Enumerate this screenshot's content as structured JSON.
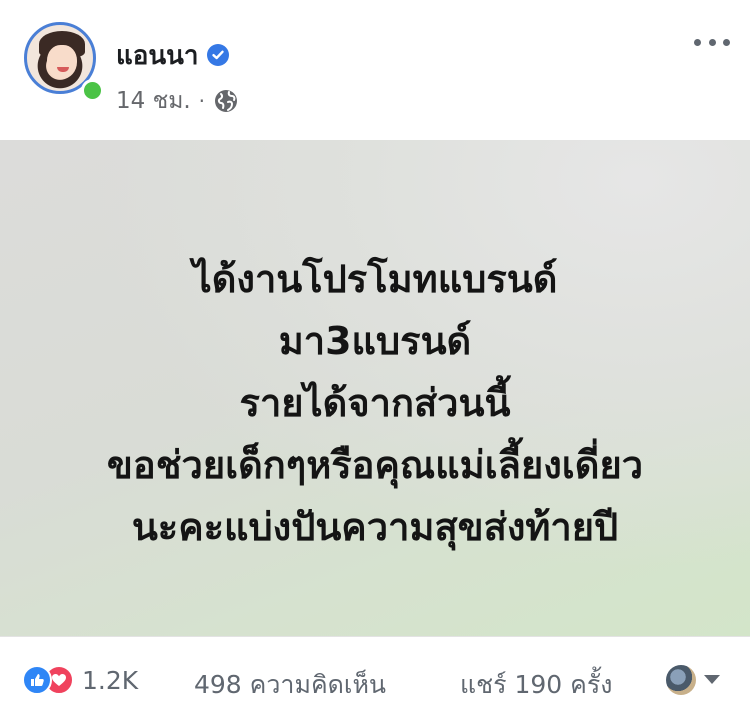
{
  "post": {
    "author_name": "แอนนา",
    "time": "14 ชม.",
    "separator": "·",
    "privacy_icon": "globe-icon",
    "verified_icon": "verified-badge-icon",
    "more_icon": "more-options-icon"
  },
  "image_text": {
    "lines": [
      "ได้งานโปรโมทแบรนด์",
      "มา3แบรนด์",
      "รายได้จากส่วนนี้",
      "ขอช่วยเด็กๆหรือคุณแม่เลี้ยงเดี่ยว",
      "นะคะแบ่งปันความสุขส่งท้ายปี"
    ]
  },
  "footer": {
    "reaction_icons": [
      "like-icon",
      "love-icon"
    ],
    "reaction_count": "1.2K",
    "comments": "498 ความคิดเห็น",
    "shares": "แชร์ 190 ครั้ง"
  },
  "colors": {
    "accent": "#3578e5",
    "online": "#4bc346",
    "like": "#2f86f6",
    "love": "#f0425d",
    "meta_text": "#65676b"
  }
}
